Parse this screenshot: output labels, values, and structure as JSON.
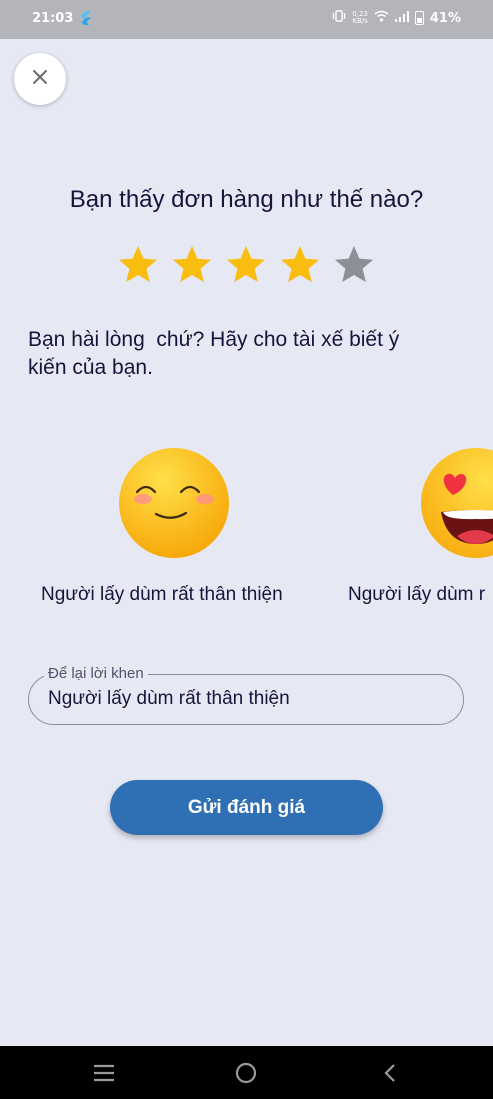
{
  "status_bar": {
    "time": "21:03",
    "net_speed_value": "0,23",
    "net_speed_unit": "KB/s",
    "battery": "41%"
  },
  "question": "Bạn thấy đơn hàng như thế nào?",
  "rating": {
    "value": 4,
    "max": 5,
    "filled_color": "#f9bd10",
    "empty_color": "#8e8e96"
  },
  "prompt": "Bạn hài lòng  chứ? Hãy cho tài xế biết ý\nkiến của bạn.",
  "feedback_options": [
    {
      "label": "Người lấy dùm rất thân thiện",
      "face": "smiling-face-icon"
    },
    {
      "label": "Người lấy dùm r",
      "face": "heart-eyes-face-icon"
    }
  ],
  "comment_field": {
    "label": "Để lại lời khen",
    "value": "Người lấy dùm rất thân thiện"
  },
  "submit_label": "Gửi đánh giá",
  "colors": {
    "background": "#e6e9f4",
    "primary": "#2f6fb3",
    "text": "#15163a"
  }
}
